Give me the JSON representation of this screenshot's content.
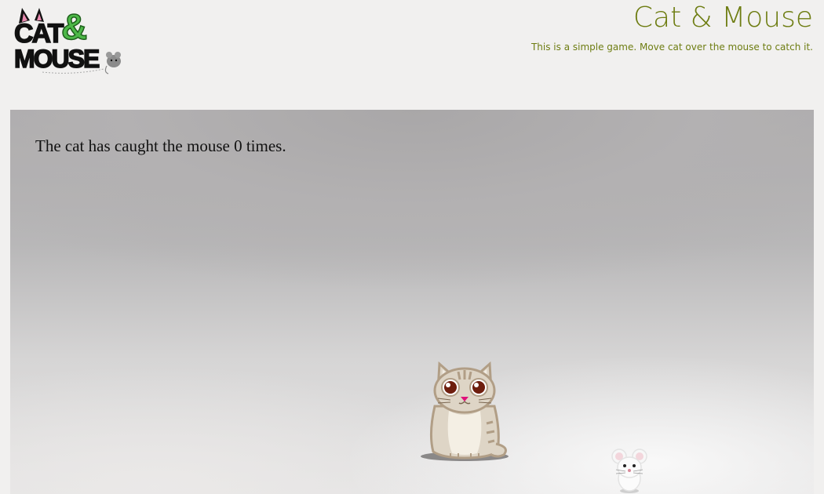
{
  "header": {
    "logo": {
      "word_1": "CAT",
      "ampersand": "&",
      "word_2": "MOUSE",
      "icon": "logo-icon"
    },
    "title": "Cat & Mouse",
    "subtitle": "This is a simple game. Move cat over the mouse to catch it."
  },
  "game": {
    "score_text": "The cat has caught the mouse 0 times.",
    "caught_count": 0,
    "sprites": {
      "cat": "cat-icon",
      "mouse": "mouse-icon"
    }
  },
  "colors": {
    "title": "#6e7d12",
    "logo_green": "#4db848",
    "background": "#f1f0ef",
    "score_text": "#111111"
  }
}
